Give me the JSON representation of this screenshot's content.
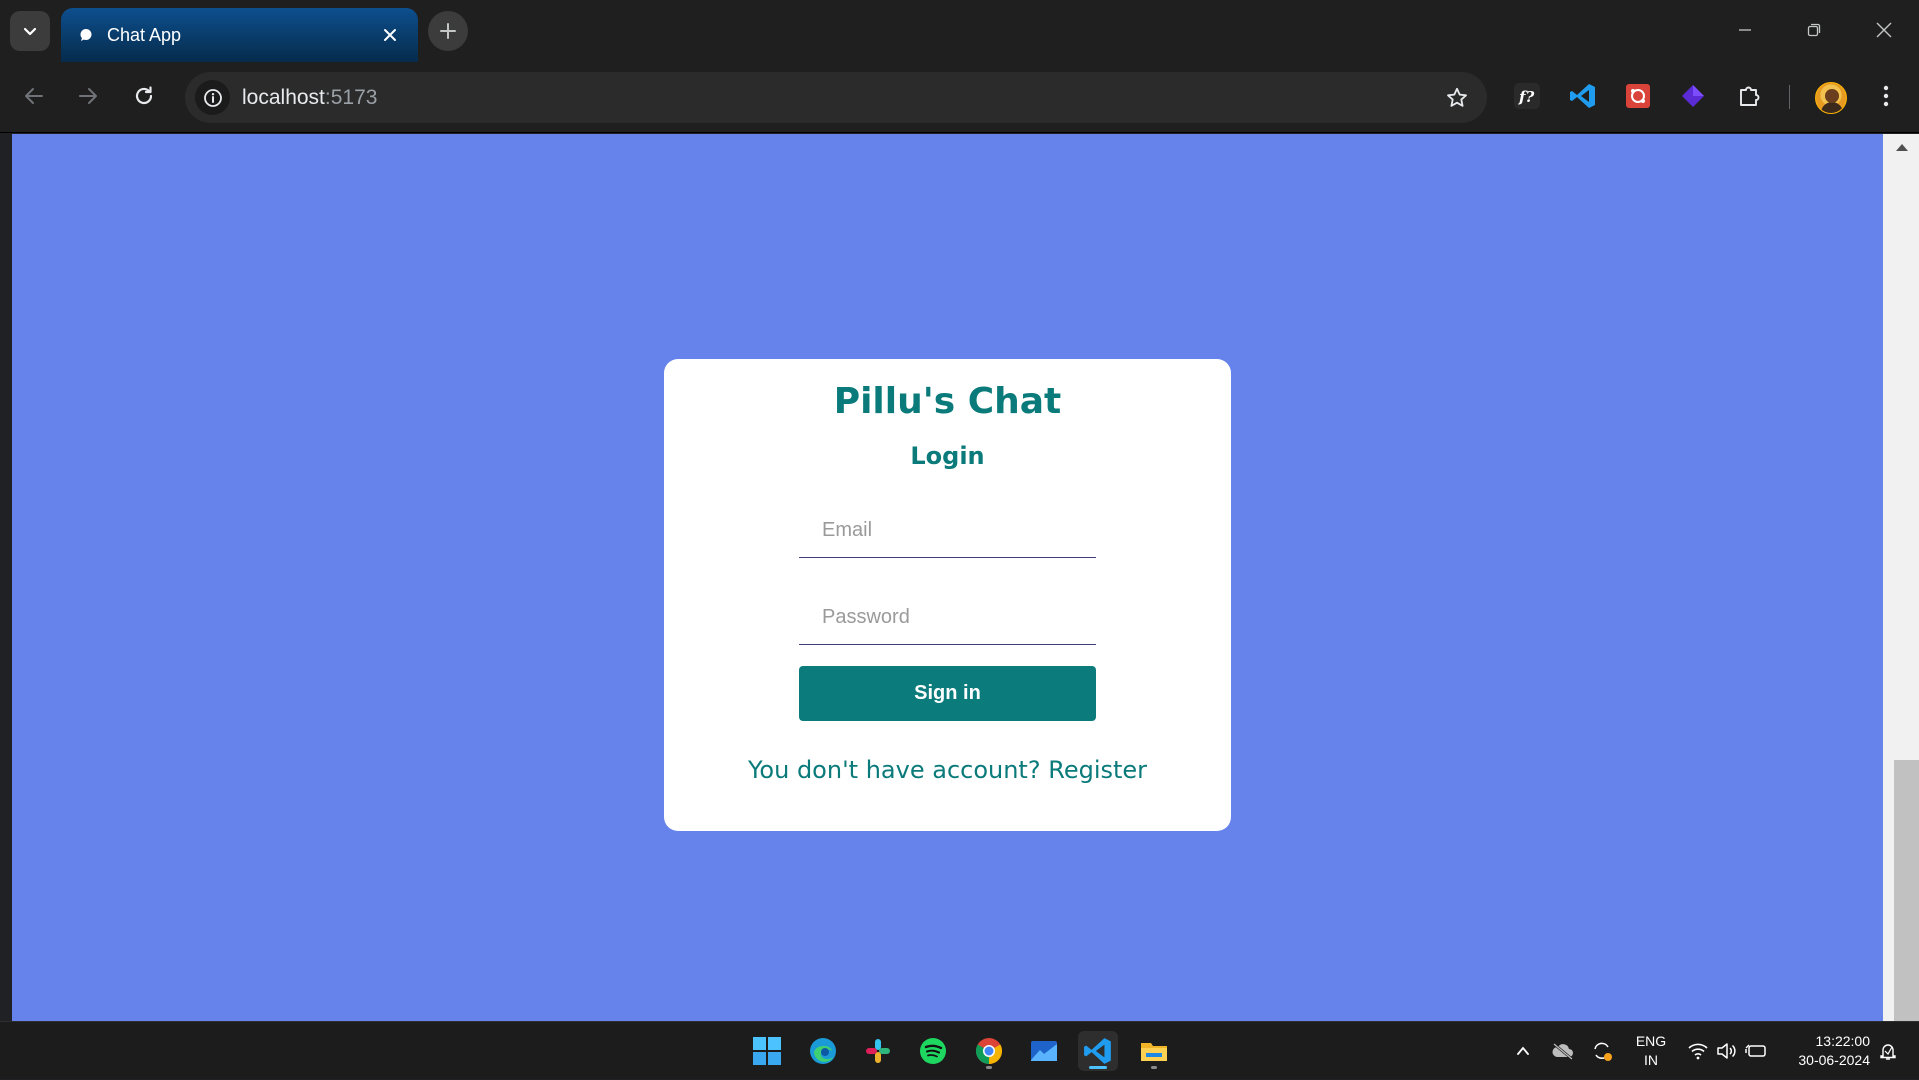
{
  "browser": {
    "tab": {
      "title": "Chat App"
    },
    "address": {
      "host": "localhost",
      "port": ":5173"
    }
  },
  "login": {
    "brand": "Pillu's Chat",
    "heading": "Login",
    "email_placeholder": "Email",
    "password_placeholder": "Password",
    "signin_label": "Sign in",
    "register_prompt": "You don't have account?",
    "register_link": "Register"
  },
  "taskbar": {
    "language_top": "ENG",
    "language_bottom": "IN",
    "time": "13:22:00",
    "date": "30-06-2024"
  },
  "colors": {
    "page_background": "#6583eb",
    "brand_teal": "#0a7a7a",
    "button_teal": "#0b7b7b",
    "tab_active": "#0d4f8f"
  },
  "icons": {
    "extensions": [
      "fonts-ninja-icon",
      "vscode-icon",
      "red-extension-icon",
      "purple-cube-icon",
      "puzzle-icon"
    ],
    "taskbar_apps": [
      "windows-start-icon",
      "edge-icon",
      "slack-icon",
      "spotify-icon",
      "chrome-icon",
      "mail-icon",
      "vscode-icon",
      "file-explorer-icon"
    ]
  }
}
